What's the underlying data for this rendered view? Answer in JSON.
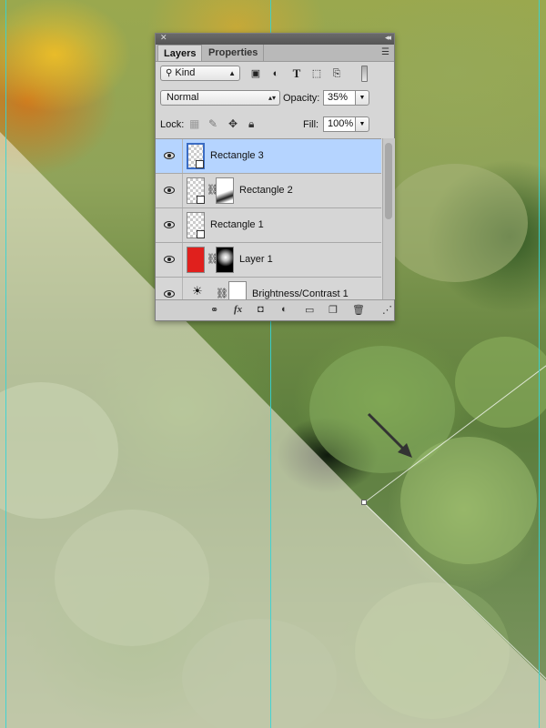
{
  "panel": {
    "tabs": [
      {
        "label": "Layers"
      },
      {
        "label": "Properties"
      }
    ],
    "filter": {
      "kind_value": "Kind",
      "icons": [
        "image-filter-icon",
        "adjustment-filter-icon",
        "type-filter-icon",
        "shape-filter-icon",
        "smart-object-filter-icon"
      ]
    },
    "blend": {
      "mode": "Normal",
      "opacity_label": "Opacity:",
      "opacity_value": "35%"
    },
    "lock": {
      "label": "Lock:",
      "fill_label": "Fill:",
      "fill_value": "100%"
    },
    "layers": [
      {
        "name": "Rectangle 3",
        "selected": true,
        "visible": true
      },
      {
        "name": "Rectangle 2",
        "selected": false,
        "visible": true
      },
      {
        "name": "Rectangle 1",
        "selected": false,
        "visible": true
      },
      {
        "name": "Layer 1",
        "selected": false,
        "visible": true
      },
      {
        "name": "Brightness/Contrast 1",
        "selected": false,
        "visible": true
      }
    ],
    "footer_icons": [
      "link-layers-icon",
      "fx-icon",
      "add-mask-icon",
      "new-adjustment-icon",
      "new-group-icon",
      "new-layer-icon",
      "trash-icon"
    ]
  },
  "colors": {
    "selected_row": "#b5d4ff",
    "guide": "#35d4d6",
    "layer1_thumb": "#e0201d"
  }
}
